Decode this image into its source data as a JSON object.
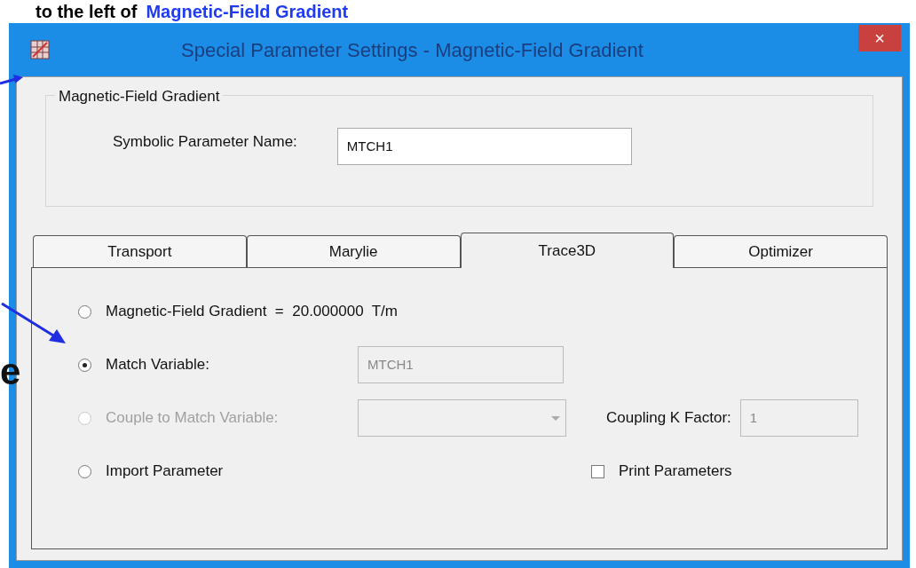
{
  "slide": {
    "caption_plain": "to the left of",
    "caption_link": "Magnetic-Field Gradient",
    "fragment": "e"
  },
  "window": {
    "title": "Special Parameter Settings - Magnetic-Field Gradient",
    "close": "×"
  },
  "group": {
    "title": "Magnetic-Field Gradient",
    "label": "Symbolic Parameter Name:",
    "value": "MTCH1"
  },
  "tabs": [
    {
      "label": "Transport",
      "selected": false
    },
    {
      "label": "Marylie",
      "selected": false
    },
    {
      "label": "Trace3D",
      "selected": true
    },
    {
      "label": "Optimizer",
      "selected": false
    }
  ],
  "options": [
    {
      "label": "Magnetic-Field Gradient  =  20.000000  T/m",
      "selected": false,
      "disabled": false
    },
    {
      "label": "Match Variable:",
      "selected": true,
      "disabled": false,
      "field": {
        "kind": "input",
        "value": "MTCH1"
      }
    },
    {
      "label": "Couple to Match Variable:",
      "selected": false,
      "disabled": true,
      "field": {
        "kind": "combo"
      },
      "extra": {
        "kind": "field",
        "label": "Coupling K Factor:",
        "value": "1"
      }
    },
    {
      "label": "Import Parameter",
      "selected": false,
      "disabled": false,
      "extra": {
        "kind": "checkbox",
        "label": "Print Parameters",
        "checked": false
      }
    }
  ]
}
